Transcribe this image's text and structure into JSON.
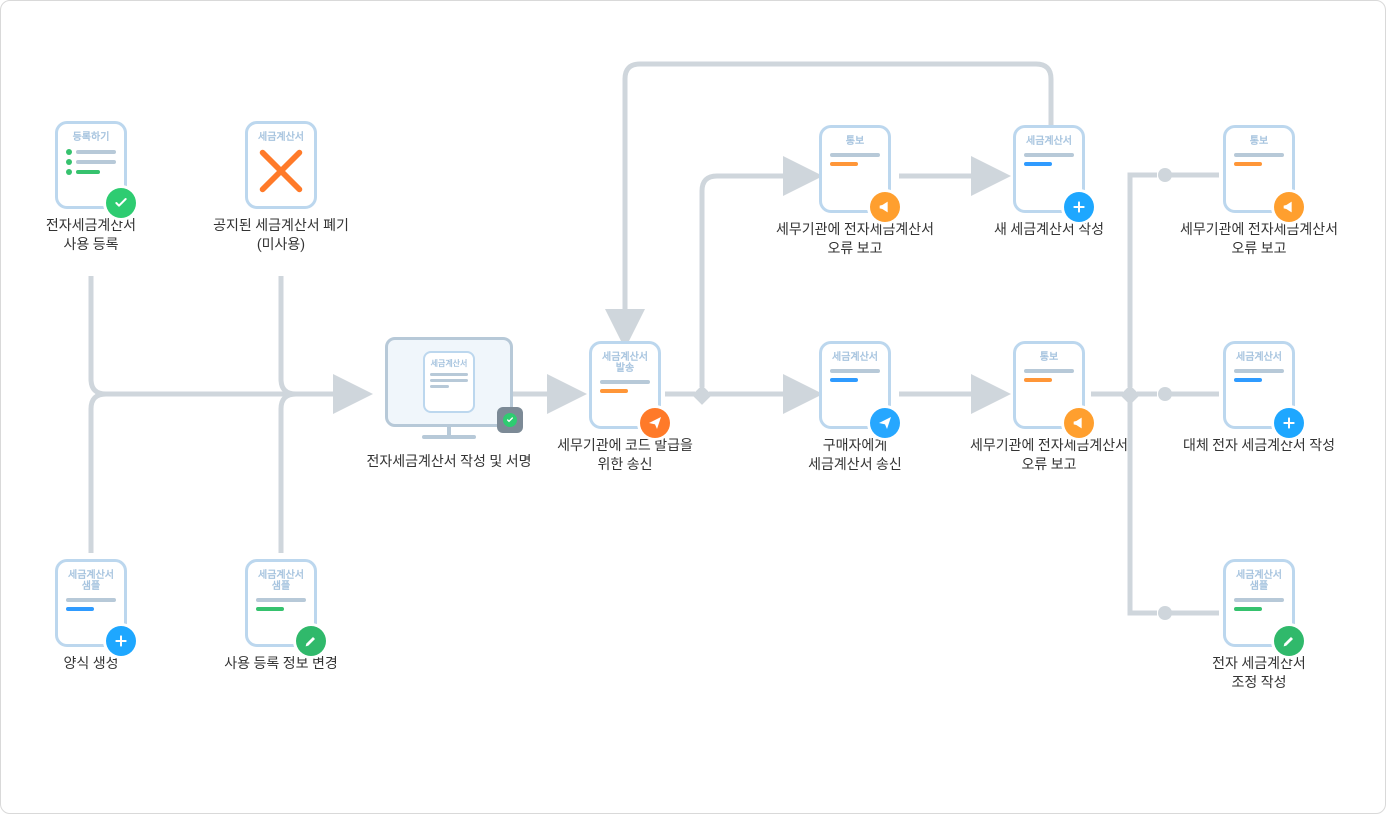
{
  "docTitles": {
    "register": "등록하기",
    "invoice": "세금계산서",
    "sample": "세금계산서\n샘플",
    "send": "세금계산서\n발송",
    "notify": "통보"
  },
  "nodes": {
    "n1": {
      "label": "전자세금계산서\n사용 등록"
    },
    "n2": {
      "label": "공지된 세금계산서 폐기\n(미사용)"
    },
    "n3": {
      "label": "양식 생성"
    },
    "n4": {
      "label": "사용 등록 정보 변경"
    },
    "n5": {
      "label": "전자세금계산서 작성 및 서명"
    },
    "n6": {
      "label": "세무기관에 코드 발급을\n위한 송신"
    },
    "n7": {
      "label": "세무기관에 전자세금계산서\n오류 보고"
    },
    "n8": {
      "label": "새 세금계산서 작성"
    },
    "n9": {
      "label": "구매자에게\n세금계산서 송신"
    },
    "n10": {
      "label": "세무기관에 전자세금계산서\n오류 보고"
    },
    "n11": {
      "label": "세무기관에 전자세금계산서\n오류 보고"
    },
    "n12": {
      "label": "대체 전자 세금계산서 작성"
    },
    "n13": {
      "label": "전자 세금계산서\n조정 작성"
    }
  },
  "colors": {
    "arrowStroke": "#cfd6dc",
    "docBorder": "#bcd7ee",
    "blue": "#2f9bff",
    "orange": "#ff9638",
    "green": "#36c26e",
    "grey": "#b7c9d8"
  }
}
